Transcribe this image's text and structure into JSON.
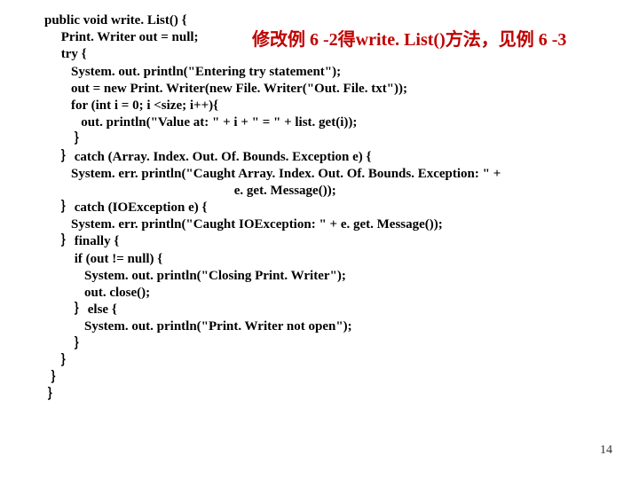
{
  "code": {
    "l1": "public void write. List() {",
    "l2": "     Print. Writer out = null;",
    "l3": "     try {",
    "l4": "        System. out. println(\"Entering try statement\");",
    "l5": "        out = new Print. Writer(new File. Writer(\"Out. File. txt\"));",
    "l6": "",
    "l7": "        for (int i = 0; i <size; i++){",
    "l8": "           out. println(\"Value at: \" + i + \" = \" + list. get(i));",
    "l9": "         ｝",
    "l10": "     ｝catch (Array. Index. Out. Of. Bounds. Exception e) {",
    "l11": "        System. err. println(\"Caught Array. Index. Out. Of. Bounds. Exception: \" +",
    "l12": "                                                         e. get. Message());",
    "l13": "     ｝catch (IOException e) {",
    "l14": "        System. err. println(\"Caught IOException: \" + e. get. Message());",
    "l15": "     ｝finally {",
    "l16": "         if (out != null) {",
    "l17": "            System. out. println(\"Closing Print. Writer\");",
    "l18": "            out. close();",
    "l19": "         ｝else {",
    "l20": "            System. out. println(\"Print. Writer not open\");",
    "l21": "         ｝",
    "l22": "     ｝",
    "l23": "  ｝",
    "l24": " ｝"
  },
  "annotation": "修改例 6 -2得write. List()方法，见例 6 -3",
  "page_number": "14"
}
